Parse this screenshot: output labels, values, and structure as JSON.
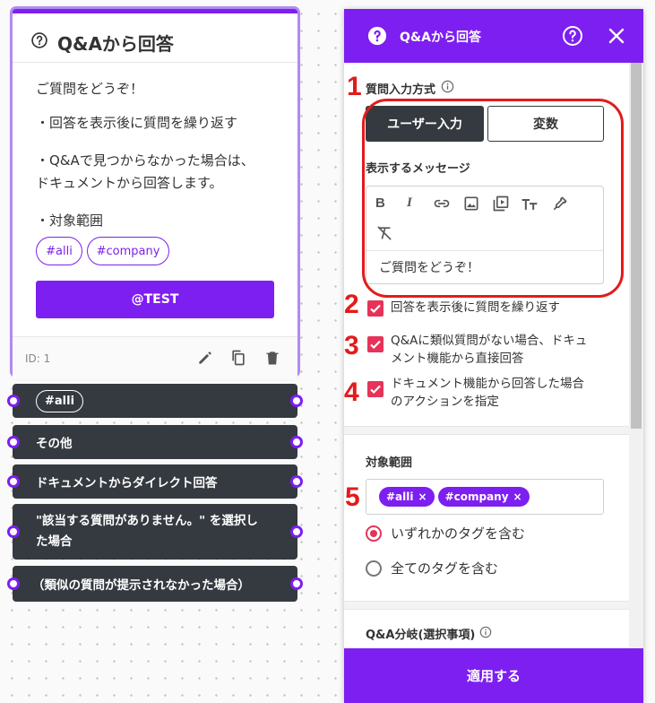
{
  "card": {
    "title": "Q&Aから回答",
    "prompt": "ご質問をどうぞ！",
    "bullet1": "・回答を表示後に質問を繰り返す",
    "bullet2_line1": "・Q&Aで見つからなかった場合は、",
    "bullet2_line2": "ドキュメントから回答します。",
    "bullet3": "・対象範囲",
    "tags": [
      "#alli",
      "#company"
    ],
    "test_button": "@TEST",
    "id_label": "ID: 1"
  },
  "branches": [
    {
      "label": "#alli"
    },
    {
      "label": "その他"
    },
    {
      "label": "ドキュメントからダイレクト回答"
    },
    {
      "label_line1": "\"該当する質問がありません。\" を選択し",
      "label_line2": "た場合"
    },
    {
      "label": "（類似の質問が提示されなかった場合）"
    }
  ],
  "panel": {
    "title": "Q&Aから回答",
    "input_method_label": "質問入力方式",
    "seg_user": "ユーザー入力",
    "seg_variable": "変数",
    "message_label": "表示するメッセージ",
    "message_text": "ご質問をどうぞ！",
    "checkbox1": "回答を表示後に質問を繰り返す",
    "checkbox2_line1": "Q&Aに類似質問がない場合、ドキュ",
    "checkbox2_line2": "メント機能から直接回答",
    "checkbox3_line1": "ドキュメント機能から回答した場合",
    "checkbox3_line2": "のアクションを指定",
    "scope_label": "対象範囲",
    "scope_tags": [
      "#alli",
      "#company"
    ],
    "radio_any": "いずれかのタグを含む",
    "radio_all": "全てのタグを含む",
    "branch_label": "Q&A分岐(選択事項)",
    "apply_button": "適用する"
  },
  "annotations": [
    "1",
    "2",
    "3",
    "4",
    "5"
  ],
  "colors": {
    "accent": "#7d1ff0",
    "dark": "#353a40",
    "checkbox": "#e6335a",
    "annotation": "#e31b1b"
  }
}
